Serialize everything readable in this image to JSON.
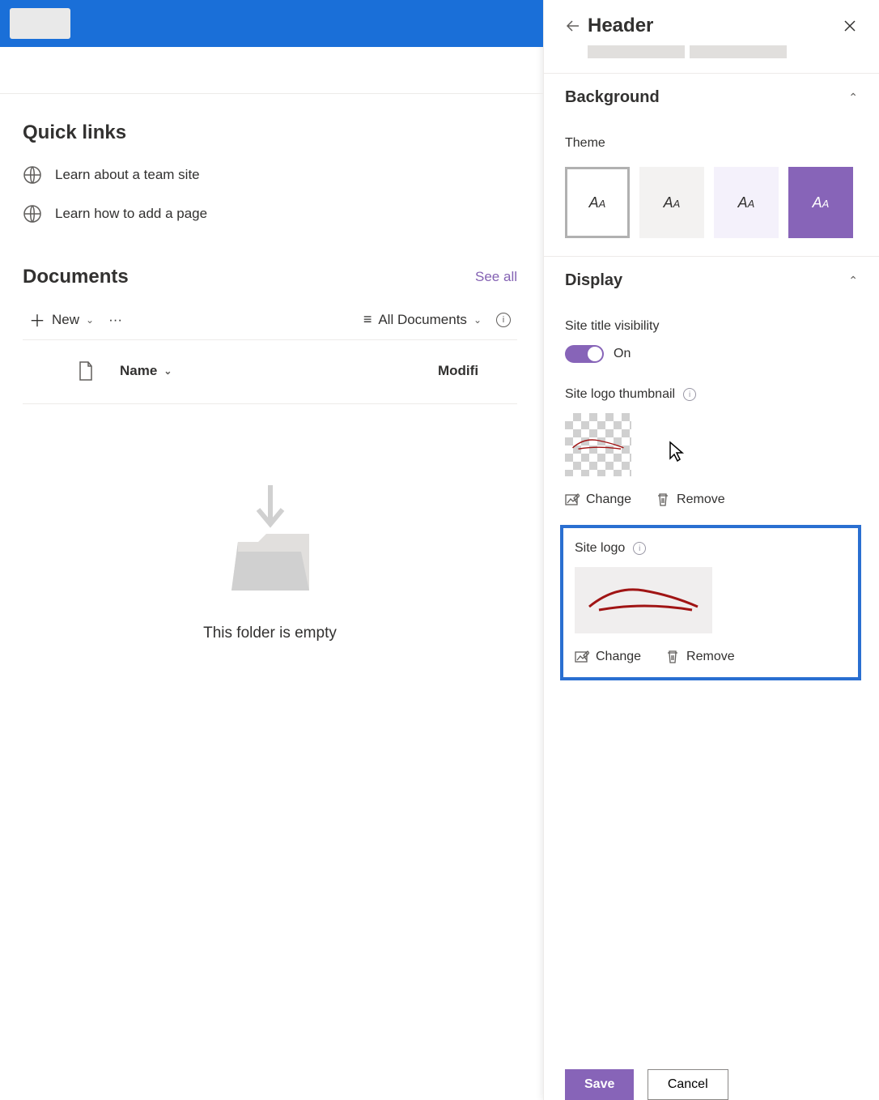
{
  "quick_links": {
    "title": "Quick links",
    "items": [
      "Learn about a team site",
      "Learn how to add a page"
    ]
  },
  "documents": {
    "title": "Documents",
    "see_all": "See all",
    "new_label": "New",
    "view_label": "All Documents",
    "column_name": "Name",
    "column_modified": "Modifi",
    "empty_text": "This folder is empty"
  },
  "panel": {
    "title": "Header",
    "background_section": "Background",
    "theme_label": "Theme",
    "display_section": "Display",
    "site_title_visibility": "Site title visibility",
    "toggle_state": "On",
    "site_logo_thumbnail": "Site logo thumbnail",
    "site_logo": "Site logo",
    "change_label": "Change",
    "remove_label": "Remove",
    "save_label": "Save",
    "cancel_label": "Cancel"
  }
}
